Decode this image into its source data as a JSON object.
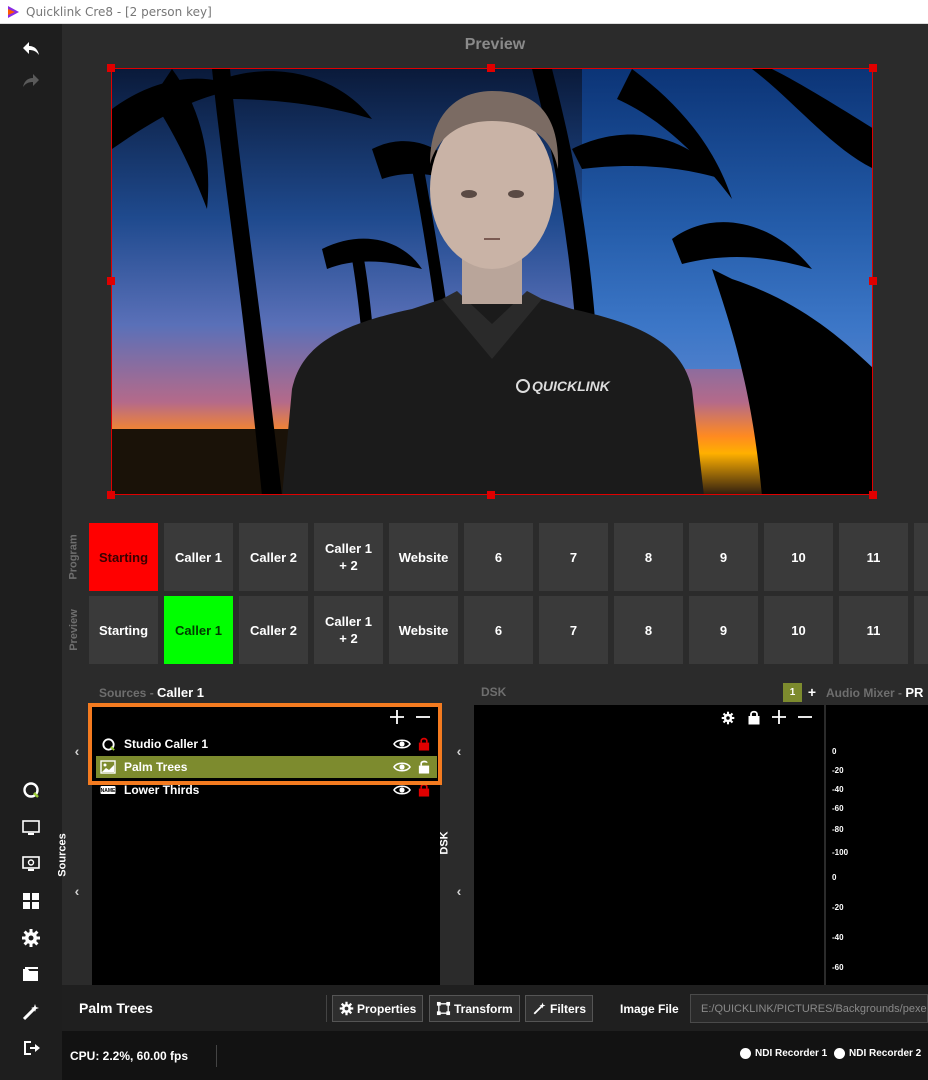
{
  "window": {
    "title": "Quicklink Cre8  - [2 person key]"
  },
  "preview": {
    "label": "Preview"
  },
  "switcher": {
    "program_label": "Program",
    "preview_label": "Preview",
    "program": [
      "Starting",
      "Caller 1",
      "Caller 2",
      "Caller 1\n+ 2",
      "Website",
      "6",
      "7",
      "8",
      "9",
      "10",
      "11"
    ],
    "preview": [
      "Starting",
      "Caller 1",
      "Caller 2",
      "Caller 1\n+ 2",
      "Website",
      "6",
      "7",
      "8",
      "9",
      "10",
      "11"
    ],
    "program_active": "Starting",
    "preview_active": "Caller 1"
  },
  "sources": {
    "header_label": "Sources",
    "header_dash": "-",
    "scene_name": "Caller 1",
    "side_label": "Sources",
    "items": [
      {
        "name": "Studio Caller 1",
        "icon": "quicklink-logo-icon",
        "locked": true,
        "selected": false
      },
      {
        "name": "Palm Trees",
        "icon": "image-icon",
        "locked": false,
        "selected": true
      },
      {
        "name": "Lower Thirds",
        "icon": "name-tag-icon",
        "locked": true,
        "selected": false
      }
    ]
  },
  "dsk": {
    "header_label": "DSK",
    "side_label": "DSK",
    "badge": "1"
  },
  "audio": {
    "header_label": "Audio Mixer",
    "header_dash": "-",
    "header_suffix": "PR",
    "scale": [
      "0",
      "-20",
      "-40",
      "-60",
      "-80",
      "-100",
      "0",
      "-20",
      "-40",
      "-60"
    ]
  },
  "properties": {
    "title": "Palm Trees",
    "properties_label": "Properties",
    "transform_label": "Transform",
    "filters_label": "Filters",
    "image_file_label": "Image File",
    "image_file_value": "E:/QUICKLINK/PICTURES/Backgrounds/pexels"
  },
  "status": {
    "cpu": "CPU: 2.2%, 60.00 fps",
    "ndi1": "NDI Recorder 1",
    "ndi2": "NDI Recorder 2"
  },
  "colors": {
    "program": "#ff0000",
    "preview": "#00ff00",
    "selected_source": "#7d8b2e",
    "highlight": "#f47b20",
    "lock_red": "#e00000"
  }
}
